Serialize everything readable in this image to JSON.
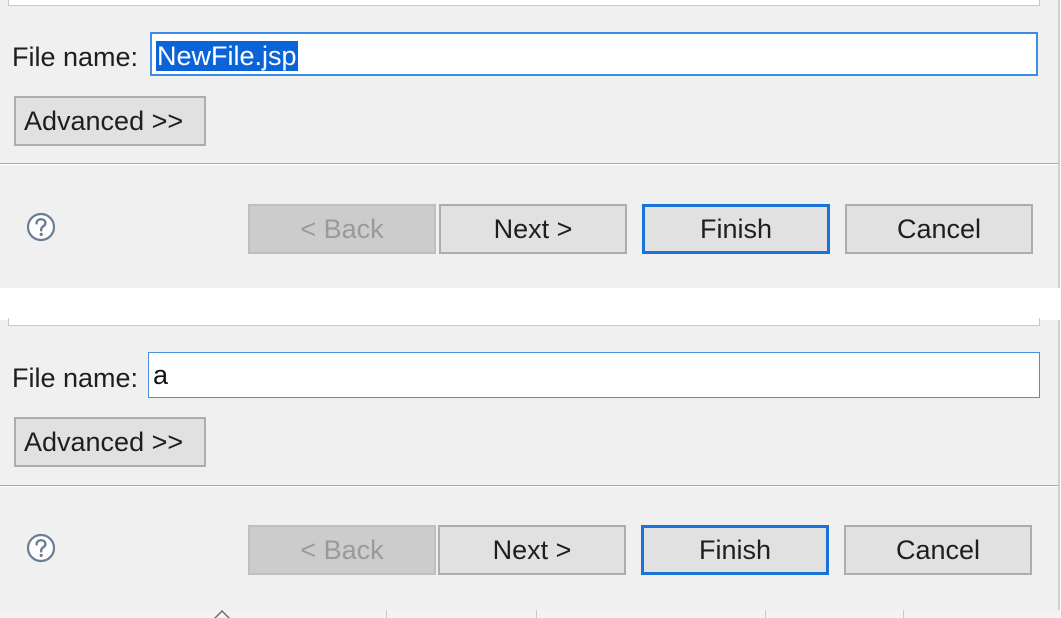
{
  "dialogs": [
    {
      "file_name_label": "File name:",
      "file_name_value": "NewFile.jsp",
      "file_name_selected": true,
      "advanced_label": "Advanced >>",
      "back_label": "< Back",
      "next_label": "Next >",
      "finish_label": "Finish",
      "cancel_label": "Cancel",
      "help_icon": "help-icon"
    },
    {
      "file_name_label": "File name:",
      "file_name_value": "a",
      "file_name_selected": false,
      "advanced_label": "Advanced >>",
      "back_label": "< Back",
      "next_label": "Next >",
      "finish_label": "Finish",
      "cancel_label": "Cancel",
      "help_icon": "help-icon"
    }
  ],
  "colors": {
    "dialog_background": "#f0f0f0",
    "focus_border": "#3a8ee6",
    "selection_highlight": "#0a64d8",
    "default_button_border": "#1a73d9",
    "disabled_button": "#cccccc"
  }
}
